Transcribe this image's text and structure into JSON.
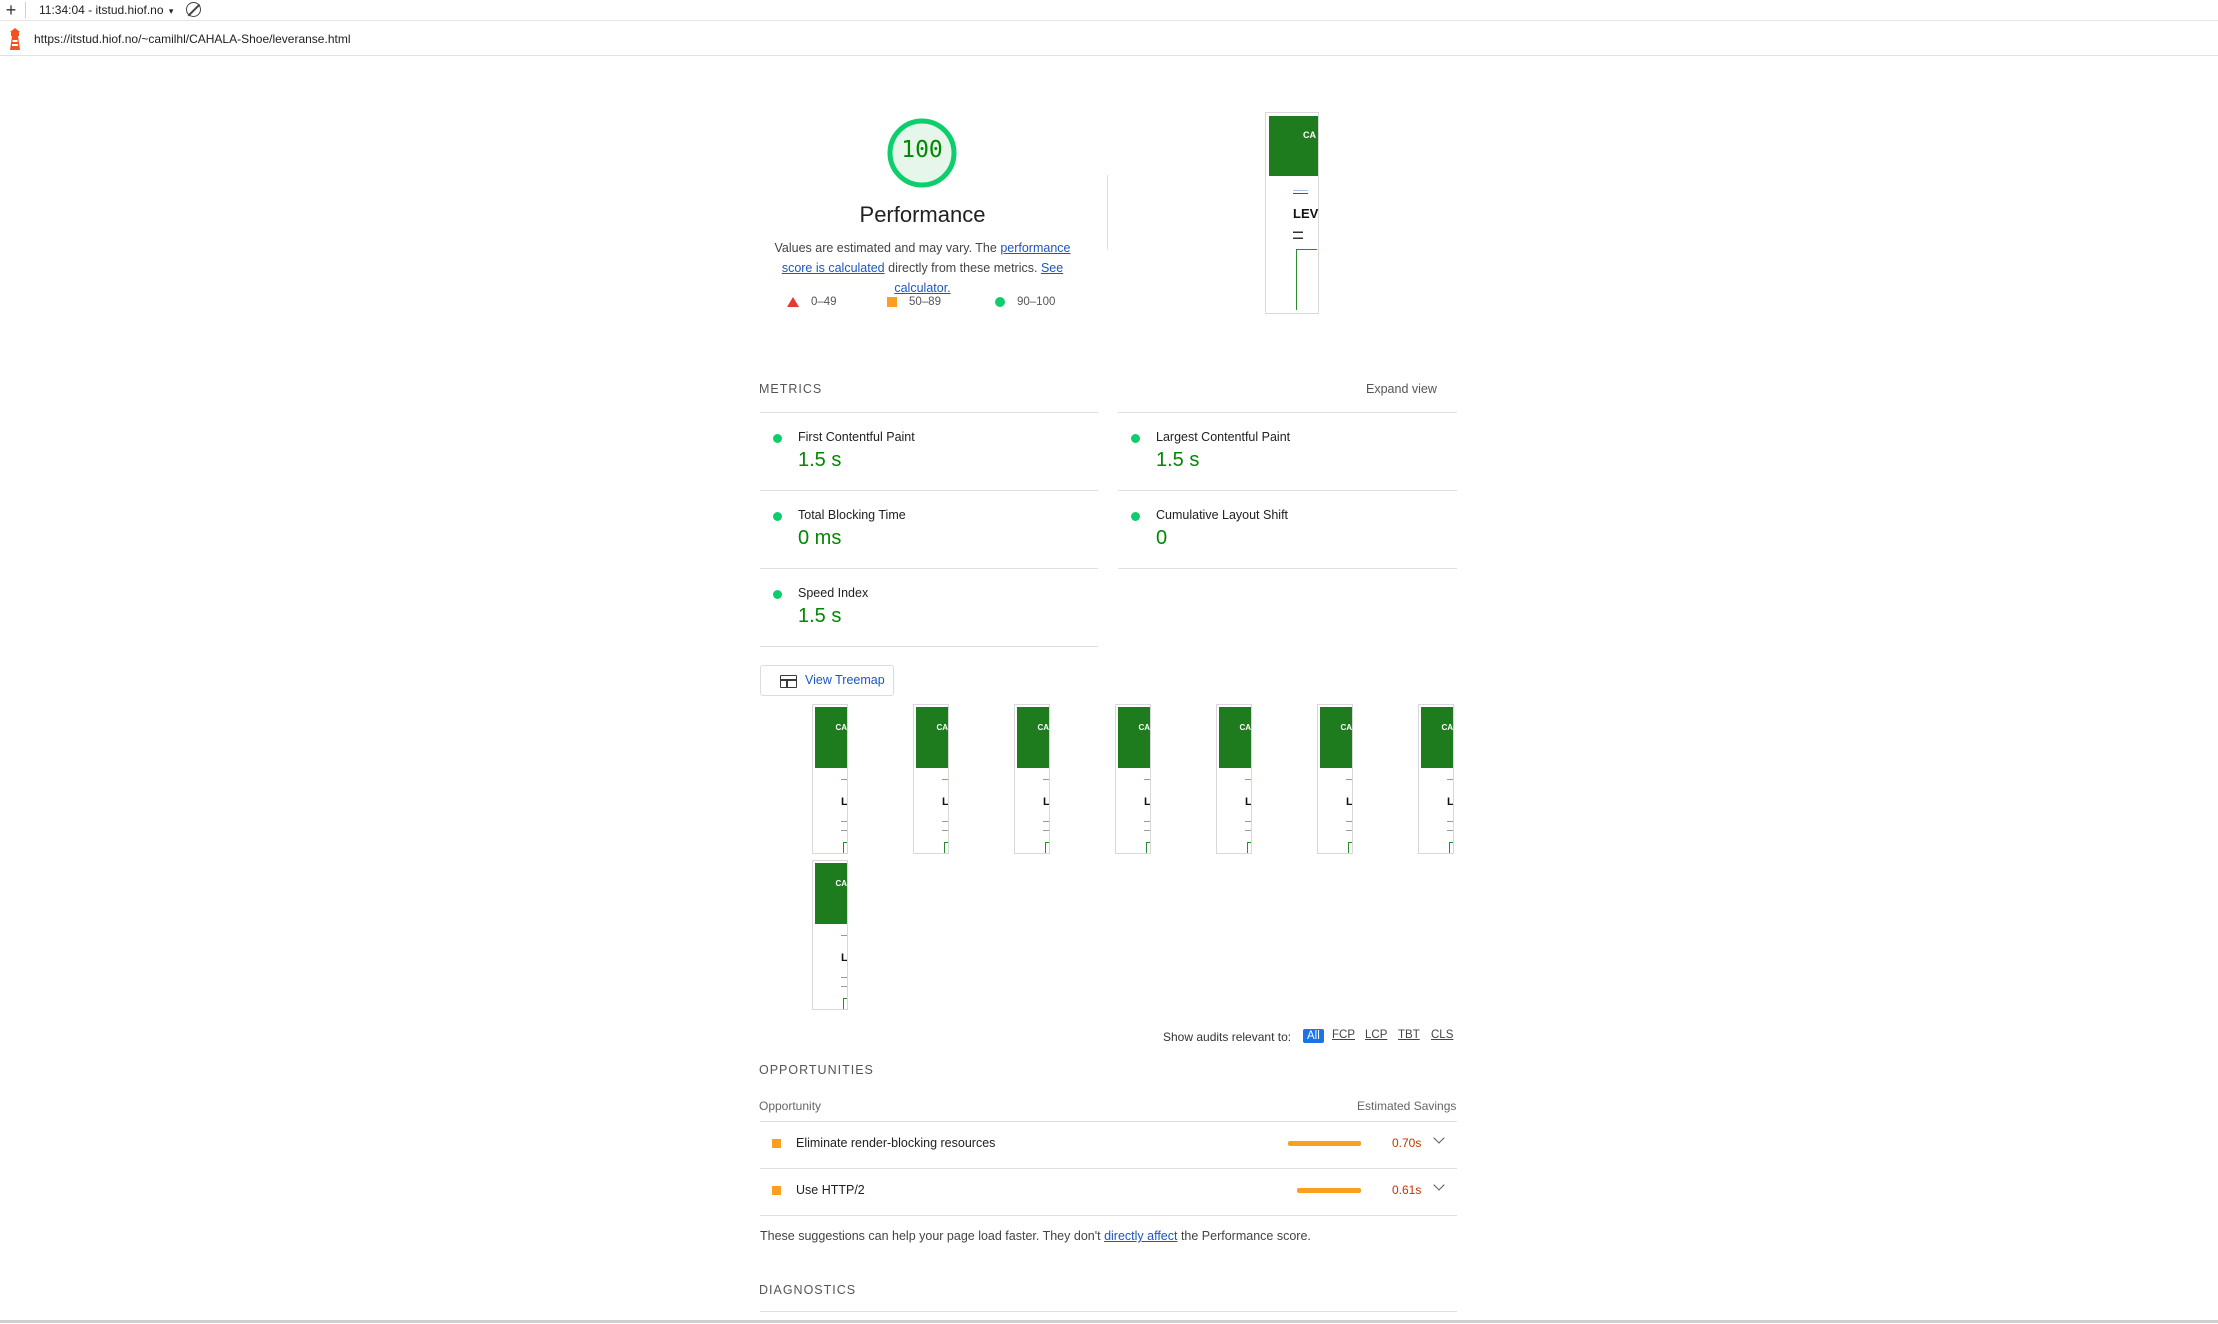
{
  "toolbar": {
    "plus_label": "+",
    "run_label": "11:34:04 - itstud.hiof.no",
    "caret": "▾"
  },
  "urlbar": {
    "url": "https://itstud.hiof.no/~camilhl/CAHALA-Shoe/leveranse.html"
  },
  "gauge": {
    "score": "100",
    "score_fraction": 1.0,
    "title": "Performance",
    "desc_prefix": "Values are estimated and may vary. The ",
    "desc_link1": "performance score is calculated",
    "desc_middle": " directly from these metrics. ",
    "desc_link2": "See calculator."
  },
  "scale": {
    "fail": "0–49",
    "average": "50–89",
    "pass": "90–100"
  },
  "thumbnail": {
    "title_fragment": "CA",
    "heading_fragment": "LEV"
  },
  "metrics": {
    "section_title": "METRICS",
    "expand_label": "Expand view",
    "items": [
      {
        "label": "First Contentful Paint",
        "value": "1.5 s"
      },
      {
        "label": "Largest Contentful Paint",
        "value": "1.5 s"
      },
      {
        "label": "Total Blocking Time",
        "value": "0 ms"
      },
      {
        "label": "Cumulative Layout Shift",
        "value": "0"
      },
      {
        "label": "Speed Index",
        "value": "1.5 s"
      }
    ]
  },
  "treemap": {
    "label": "View Treemap"
  },
  "filter": {
    "label": "Show audits relevant to:",
    "chips": [
      "All",
      "FCP",
      "LCP",
      "TBT",
      "CLS"
    ]
  },
  "opportunities": {
    "section_title": "OPPORTUNITIES",
    "col_opportunity": "Opportunity",
    "col_savings": "Estimated Savings",
    "rows": [
      {
        "title": "Eliminate render-blocking resources",
        "savings": "0.70s",
        "bar_fraction": 1.0
      },
      {
        "title": "Use HTTP/2",
        "savings": "0.61s",
        "bar_fraction": 0.87
      }
    ],
    "note_prefix": "These suggestions can help your page load faster. They don't ",
    "note_link": "directly affect",
    "note_suffix": " the Performance score."
  },
  "diagnostics": {
    "section_title": "DIAGNOSTICS"
  },
  "colors": {
    "pass": "#0cce6b",
    "pass_text": "#008800",
    "average": "#fa9f1e",
    "fail": "#e53935",
    "link": "#1a56c4",
    "thumb_header": "#1e7b1e"
  }
}
